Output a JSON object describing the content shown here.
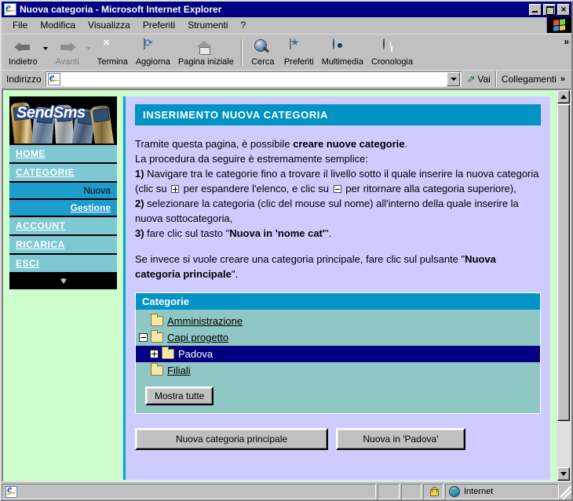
{
  "window": {
    "title": "Nuova categoria - Microsoft Internet Explorer",
    "minimize_label": "",
    "maximize_label": "",
    "close_label": "✕"
  },
  "menubar": {
    "items": [
      {
        "label": "File"
      },
      {
        "label": "Modifica"
      },
      {
        "label": "Visualizza"
      },
      {
        "label": "Preferiti"
      },
      {
        "label": "Strumenti"
      },
      {
        "label": "?"
      }
    ]
  },
  "toolbar": {
    "back_label": "Indietro",
    "forward_label": "Avanti",
    "stop_label": "Termina",
    "refresh_label": "Aggiorna",
    "home_label": "Pagina iniziale",
    "search_label": "Cerca",
    "favorites_label": "Preferiti",
    "media_label": "Multimedia",
    "history_label": "Cronologia",
    "overflow_label": "»"
  },
  "addressbar": {
    "label": "Indirizzo",
    "value": "",
    "placeholder": "",
    "go_label": "Vai",
    "links_label": "Collegamenti",
    "links_overflow": "»"
  },
  "sidebar": {
    "banner_text": "SendSms",
    "items": [
      {
        "label": "HOME",
        "type": "main"
      },
      {
        "label": "CATEGORIE",
        "type": "main"
      },
      {
        "label": "Nuova",
        "type": "sub",
        "active": false
      },
      {
        "label": "Gestione",
        "type": "sub",
        "active": true
      },
      {
        "label": "ACCOUNT",
        "type": "main"
      },
      {
        "label": "RICARICA",
        "type": "main"
      },
      {
        "label": "ESCI",
        "type": "main"
      }
    ]
  },
  "content": {
    "header": "INSERIMENTO NUOVA CATEGORIA",
    "intro": {
      "line1_a": "Tramite questa pagina, è possibile ",
      "line1_b": "creare nuove categorie",
      "line1_c": ".",
      "line2": "La procedura da seguire è estremamente semplice:",
      "step1_num": "1)",
      "step1_a": " Navigare tra le categorie fino a trovare il livello sotto il quale inserire la nuova categoria (clic su ",
      "step1_b": " per espandere l'elenco, e clic su ",
      "step1_c": " per ritornare alla categoria superiore),",
      "step2_num": "2)",
      "step2_text": " selezionare la categoria (clic del mouse sul nome) all'interno della quale inserire la nuova sottocategoria,",
      "step3_num": "3)",
      "step3_a": " fare clic sul tasto \"",
      "step3_b": "Nuova in 'nome cat'",
      "step3_c": "\".",
      "note_a": "Se invece si vuole creare una categoria principale, fare clic sul pulsante \"",
      "note_b": "Nuova categoria principale",
      "note_c": "\"."
    },
    "tree": {
      "header": "Categorie",
      "rows": [
        {
          "label": "Amministrazione",
          "toggle": "none",
          "indent": 0,
          "selected": false
        },
        {
          "label": "Capi progetto",
          "toggle": "minus",
          "indent": 0,
          "selected": false
        },
        {
          "label": "Padova",
          "toggle": "plus",
          "indent": 1,
          "selected": true
        },
        {
          "label": "Filiali",
          "toggle": "none",
          "indent": 0,
          "selected": false
        }
      ],
      "show_all_button": "Mostra tutte"
    },
    "buttons": {
      "new_main": "Nuova categoria principale",
      "new_in": "Nuova in 'Padova'"
    }
  },
  "statusbar": {
    "message": "",
    "zone": "Internet"
  },
  "colors": {
    "titlebar": "#000080",
    "page_bg": "#ccffcc",
    "content_bg": "#ccccff",
    "header_bar": "#0093c4",
    "sidebar_bg": "#7ec8d3",
    "sidebar_sub_bg": "#1e9ccc",
    "tree_bg": "#8fc7c4",
    "selection": "#000080"
  }
}
